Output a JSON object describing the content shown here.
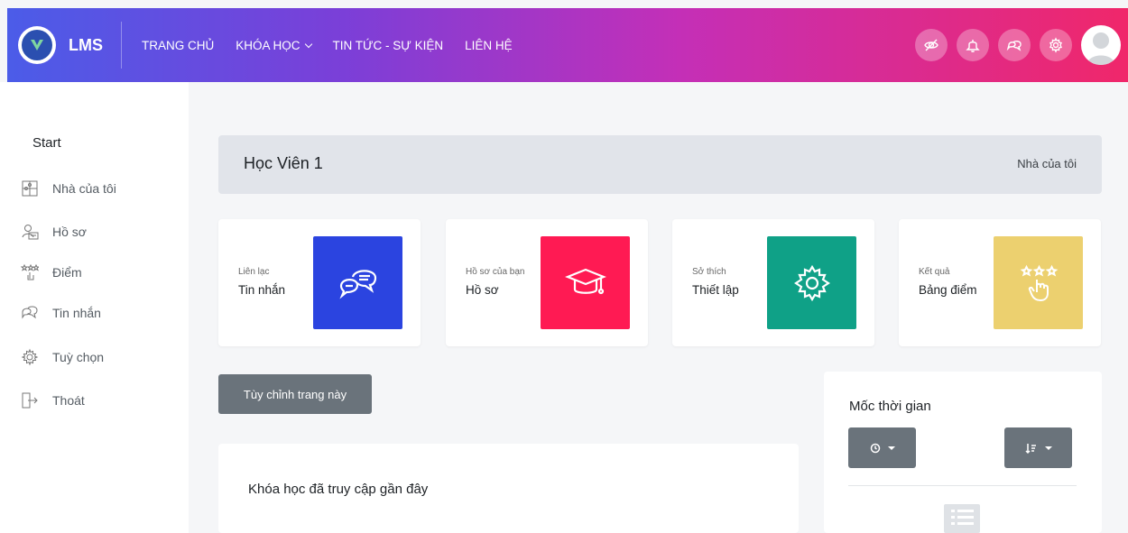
{
  "header": {
    "brand": "LMS",
    "nav": [
      {
        "label": "TRANG CHỦ"
      },
      {
        "label": "KHÓA HỌC"
      },
      {
        "label": "TIN TỨC - SỰ KIỆN"
      },
      {
        "label": "LIÊN HỆ"
      }
    ],
    "icons": [
      "eye-slash-icon",
      "bell-icon",
      "messages-icon",
      "settings-icon"
    ],
    "gradient": [
      "#4b5ce8",
      "#7b3fd8",
      "#c42fb7",
      "#f0276a"
    ]
  },
  "sidebar": {
    "title": "Start",
    "items": [
      {
        "label": "Nhà của tôi",
        "icon": "puzzle-icon"
      },
      {
        "label": "Hồ sơ",
        "icon": "profile-icon"
      },
      {
        "label": "Điểm",
        "icon": "star-hand-icon"
      },
      {
        "label": "Tin nhắn",
        "icon": "chat-icon"
      },
      {
        "label": "Tuỳ chọn",
        "icon": "gear-icon"
      },
      {
        "label": "Thoát",
        "icon": "logout-icon"
      }
    ]
  },
  "page": {
    "title": "Học Viên 1",
    "breadcrumb": "Nhà của tôi"
  },
  "cards": [
    {
      "sub": "Liên lạc",
      "main": "Tin nhắn",
      "color": "#2b44e0",
      "icon": "chat-bubbles-icon"
    },
    {
      "sub": "Hồ sơ của bạn",
      "main": "Hồ sơ",
      "color": "#ff1a53",
      "icon": "graduation-cap-icon"
    },
    {
      "sub": "Sở thích",
      "main": "Thiết lập",
      "color": "#0fa187",
      "icon": "gear-icon"
    },
    {
      "sub": "Kết quả",
      "main": "Bảng điểm",
      "color": "#ecd06f",
      "icon": "stars-hand-icon"
    }
  ],
  "customise_button": "Tùy chỉnh trang này",
  "recent": {
    "title": "Khóa học đã truy cập gần đây"
  },
  "timeline": {
    "title": "Mốc thời gian"
  }
}
